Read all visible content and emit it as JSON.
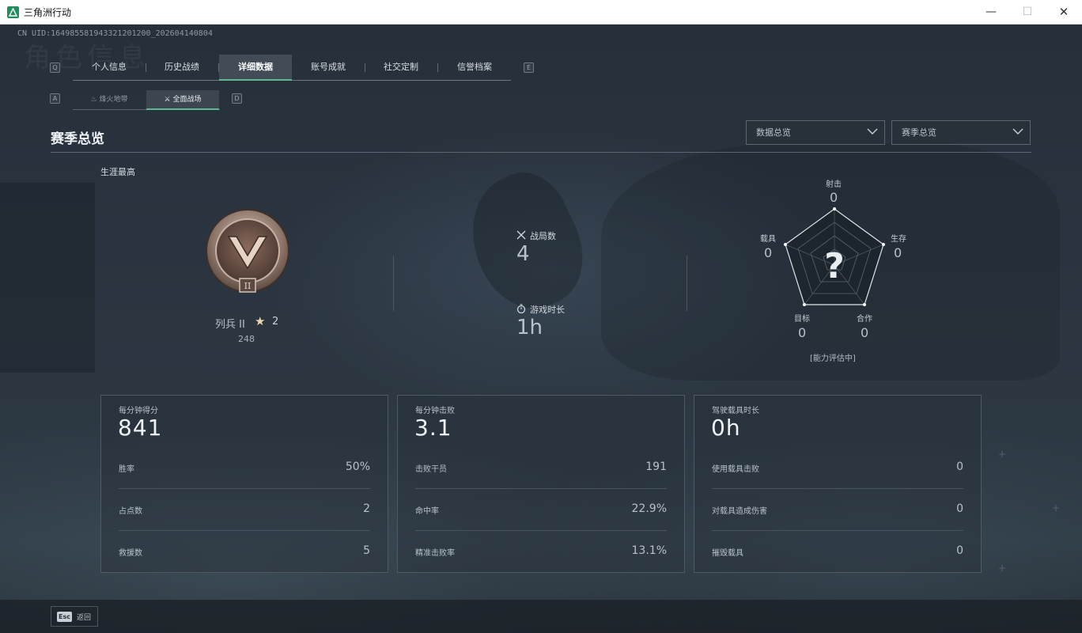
{
  "window": {
    "title": "三角洲行动",
    "minimize": "—",
    "maximize": "☐",
    "close": "✕"
  },
  "header": {
    "uid": "CN UID:1649855819433212012​00_202604140804",
    "watermark": "角色信息"
  },
  "tabs": {
    "left_key": "Q",
    "right_key": "E",
    "items": [
      {
        "label": "个人信息"
      },
      {
        "label": "历史战绩"
      },
      {
        "label": "详细数据",
        "active": true
      },
      {
        "label": "账号成就"
      },
      {
        "label": "社交定制"
      },
      {
        "label": "信誉档案"
      }
    ]
  },
  "subtabs": {
    "left_key": "A",
    "right_key": "D",
    "items": [
      {
        "label": "烽火地带",
        "icon": "flame-icon"
      },
      {
        "label": "全面战场",
        "icon": "battlefield-icon",
        "active": true
      }
    ]
  },
  "section": {
    "title": "赛季总览",
    "dropdown1": "数据总览",
    "dropdown2": "赛季总览"
  },
  "rank": {
    "label": "生涯最高",
    "name": "列兵 II",
    "stars": "2",
    "score": "248",
    "badge_numeral": "II"
  },
  "summary": {
    "battles_label": "战局数",
    "battles_value": "4",
    "time_label": "游戏时长",
    "time_value": "1h"
  },
  "radar": {
    "center": "?",
    "note": "[能力评估中]",
    "axes": [
      {
        "label": "射击",
        "value": "0"
      },
      {
        "label": "生存",
        "value": "0"
      },
      {
        "label": "合作",
        "value": "0"
      },
      {
        "label": "目标",
        "value": "0"
      },
      {
        "label": "载具",
        "value": "0"
      }
    ]
  },
  "cards": [
    {
      "head": "每分钟得分",
      "big": "841",
      "rows": [
        {
          "k": "胜率",
          "v": "50%"
        },
        {
          "k": "占点数",
          "v": "2"
        },
        {
          "k": "救援数",
          "v": "5"
        }
      ]
    },
    {
      "head": "每分钟击败",
      "big": "3.1",
      "rows": [
        {
          "k": "击败干员",
          "v": "191"
        },
        {
          "k": "命中率",
          "v": "22.9%"
        },
        {
          "k": "精准击败率",
          "v": "13.1%"
        }
      ]
    },
    {
      "head": "驾驶载具时长",
      "big": "0h",
      "rows": [
        {
          "k": "使用载具击败",
          "v": "0"
        },
        {
          "k": "对载具造成伤害",
          "v": "0"
        },
        {
          "k": "摧毁载具",
          "v": "0"
        }
      ]
    }
  ],
  "footer": {
    "esc_key": "Esc",
    "esc_label": "返回"
  },
  "colors": {
    "accent": "#5fb88b",
    "background": "#26303a",
    "text": "#b9c2ca"
  }
}
